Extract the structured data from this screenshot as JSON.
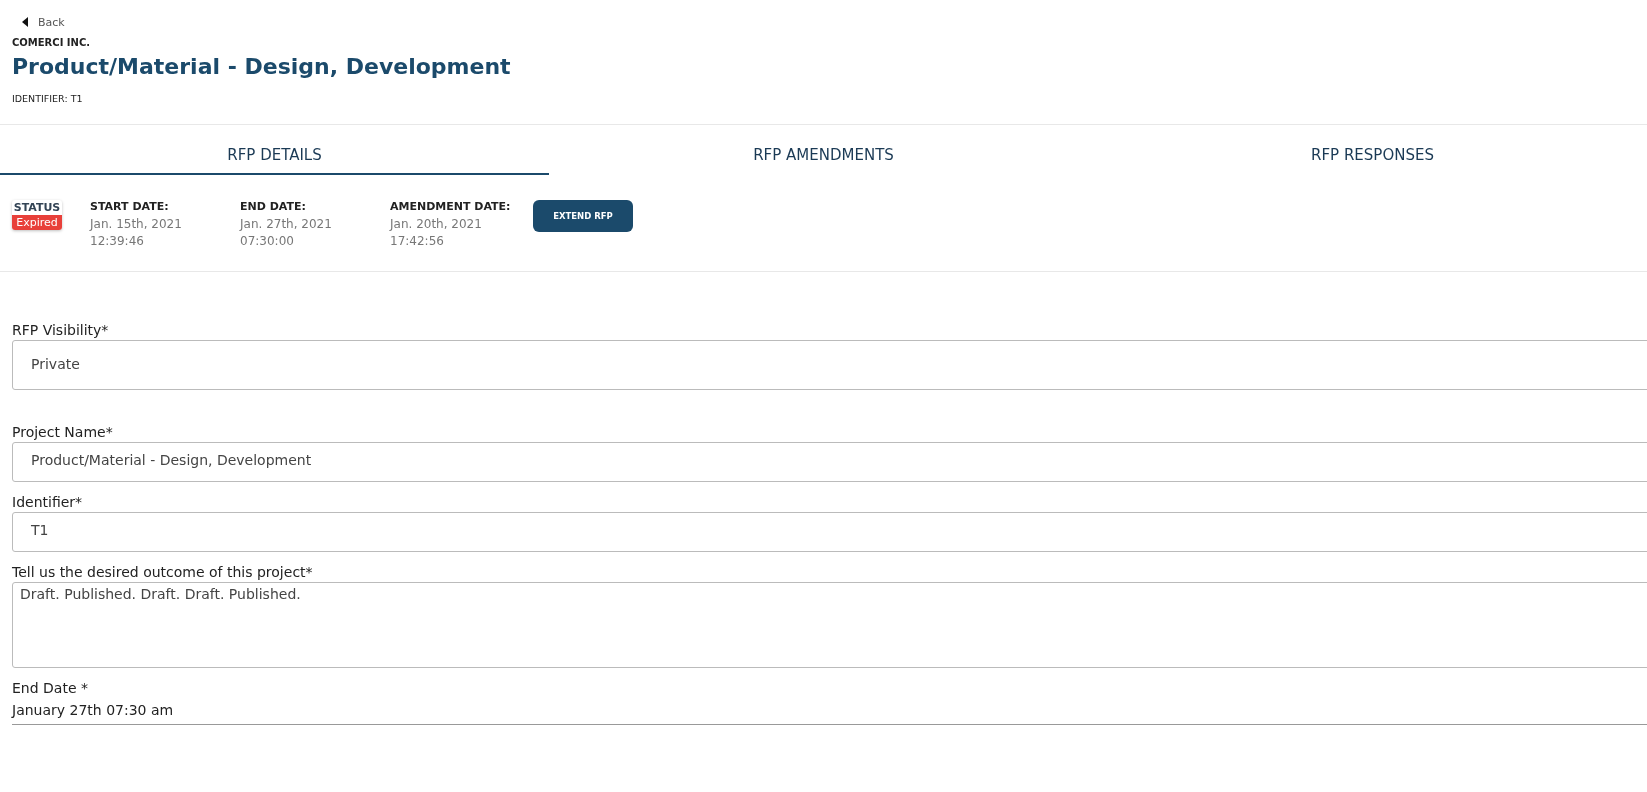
{
  "back_link": "Back",
  "company": "COMERCI INC.",
  "title": "Product/Material - Design, Development",
  "identifier": "IDENTIFIER: T1",
  "tabs": [
    {
      "label": "RFP DETAILS",
      "selected": true
    },
    {
      "label": "RFP AMENDMENTS",
      "selected": false
    },
    {
      "label": "RFP RESPONSES",
      "selected": false
    }
  ],
  "status": {
    "label": "STATUS",
    "value": "Expired"
  },
  "dates": [
    {
      "label": "START DATE:",
      "date": "Jan. 15th, 2021",
      "time": "12:39:46"
    },
    {
      "label": "END DATE:",
      "date": "Jan. 27th, 2021",
      "time": "07:30:00"
    },
    {
      "label": "AMENDMENT DATE:",
      "date": "Jan. 20th, 2021",
      "time": "17:42:56"
    }
  ],
  "extend_button": "EXTEND RFP",
  "fields": [
    {
      "kind": "select",
      "label": "RFP Visibility*",
      "value": "Private"
    },
    {
      "kind": "text",
      "label": "Project Name*",
      "value": "Product/Material - Design, Development"
    },
    {
      "kind": "text",
      "label": "Identifier*",
      "value": "T1"
    },
    {
      "kind": "textarea",
      "label": "Tell us the desired outcome of this project*",
      "value": "Draft. Published. Draft. Draft. Published."
    },
    {
      "kind": "date",
      "label": "End Date *",
      "value": "January 27th 07:30 am"
    }
  ]
}
